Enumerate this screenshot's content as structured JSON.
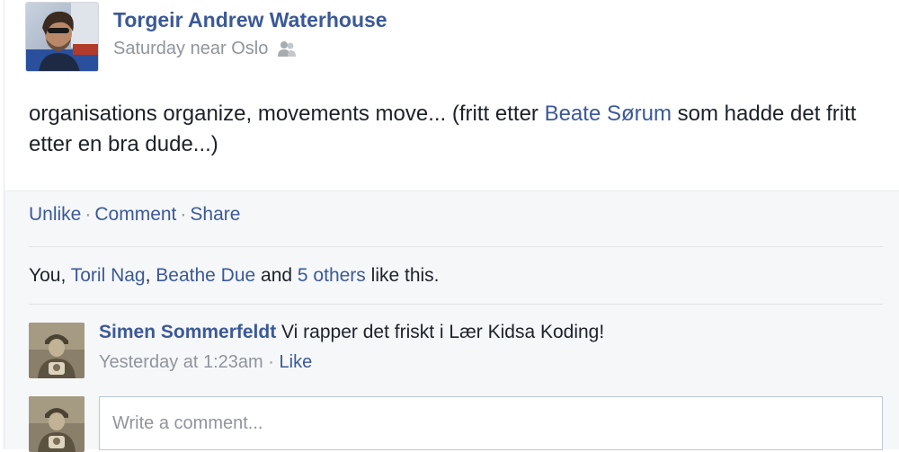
{
  "post": {
    "author": {
      "name": "Torgeir Andrew Waterhouse",
      "avatar_icon": "author-profile-photo"
    },
    "meta": {
      "time": "Saturday",
      "location": "near Oslo",
      "privacy_icon": "friends-icon"
    },
    "text": {
      "part1": "organisations organize, movements move... (fritt etter ",
      "mention": "Beate Sørum",
      "part2": " som hadde det fritt etter en bra dude...)"
    }
  },
  "actions": {
    "unlike": "Unlike",
    "comment": "Comment",
    "share": "Share",
    "separator": "·"
  },
  "likes": {
    "you": "You, ",
    "person1": "Toril Nag",
    "comma": ", ",
    "person2": "Beathe Due",
    "and": " and ",
    "others": "5 others",
    "suffix": " like this."
  },
  "comments": [
    {
      "author": "Simen Sommerfeldt",
      "text": " Vi rapper det friskt i Lær Kidsa Koding!",
      "time": "Yesterday at 1:23am",
      "separator": " · ",
      "like": "Like"
    }
  ],
  "comment_box": {
    "placeholder": "Write a comment..."
  },
  "colors": {
    "link": "#3b5998",
    "text": "#1d2129",
    "meta": "#90949c",
    "ufi_background": "#f6f7f9"
  }
}
